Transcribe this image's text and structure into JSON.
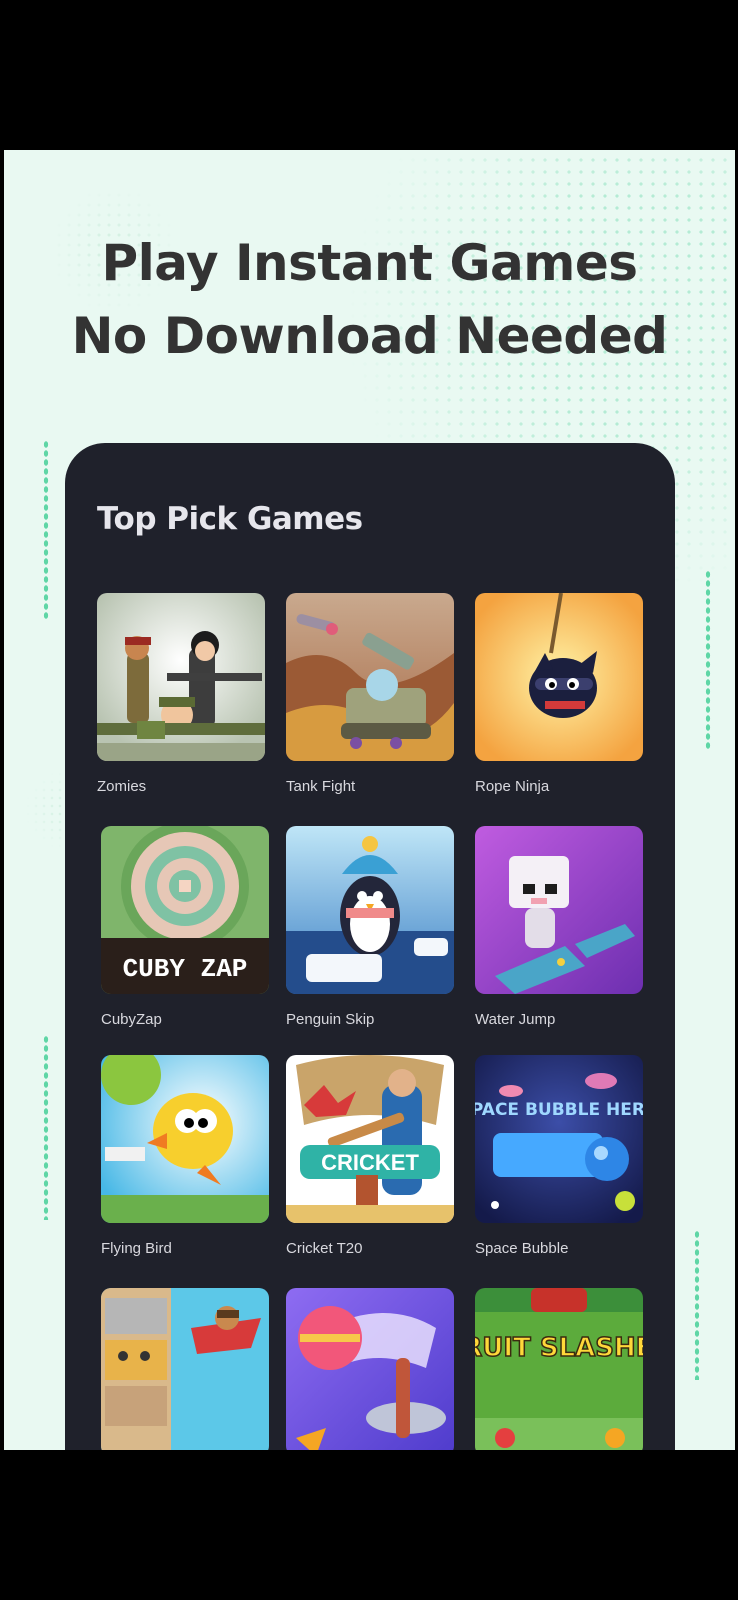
{
  "hero": {
    "line1": "Play Instant Games",
    "line2": "No Download Needed"
  },
  "panel": {
    "title": "Top Pick Games"
  },
  "games": [
    {
      "name": "Zomies"
    },
    {
      "name": "Tank Fight"
    },
    {
      "name": "Rope Ninja"
    },
    {
      "name": "CubyZap",
      "logo_text": "CUBY ZAP"
    },
    {
      "name": "Penguin Skip"
    },
    {
      "name": "Water Jump"
    },
    {
      "name": "Flying Bird"
    },
    {
      "name": "Cricket T20",
      "logo_text": "CRICKET"
    },
    {
      "name": "Space Bubble",
      "logo_text": "SPACE BUBBLE HERO"
    },
    {
      "name": ""
    },
    {
      "name": ""
    },
    {
      "name": "",
      "logo_text": "FRUIT SLASHER"
    }
  ],
  "colors": {
    "background": "#e9f9f2",
    "panel": "#1f212b",
    "accent_dots": "#5fd6a6",
    "headline": "#333333"
  }
}
